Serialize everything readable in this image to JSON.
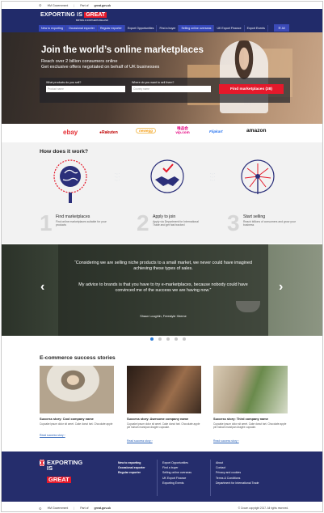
{
  "govbar": {
    "hm": "HM Government",
    "part_of": "Part of",
    "site": "great.gov.uk"
  },
  "header": {
    "logo_word": "EXPORTING IS",
    "logo_great": "GREAT",
    "logo_sub": "BRITAIN & NORTHERN IRELAND",
    "nav": [
      "New to exporting",
      "Occasional exporter",
      "Regular exporter",
      "Export Opportunities",
      "Find a buyer",
      "Selling online overseas",
      "UK Export Finance",
      "Export Events"
    ],
    "all_label": "All"
  },
  "hero": {
    "title": "Join the world’s online marketplaces",
    "line1": "Reach over 2 billion consumers online",
    "line2": "Get exclusive offers negotiated on behalf of UK businesses",
    "products_label": "What products do you sell?",
    "products_placeholder": "Product name",
    "country_label": "Where do you want to sell them?",
    "country_placeholder": "Country name",
    "button": "Find marketplaces (38)"
  },
  "marketplaces": [
    "ebay",
    "Rakuten",
    "newegg",
    "唯品会 vip.com",
    "Flipkart",
    "amazon"
  ],
  "how": {
    "title": "How does it work?",
    "steps": [
      {
        "num": "1",
        "title": "Find marketplaces",
        "desc": "Find online marketplaces suitable for your products"
      },
      {
        "num": "2",
        "title": "Apply to join",
        "desc": "Apply via Department for International Trade and get fast tracked"
      },
      {
        "num": "3",
        "title": "Start selling",
        "desc": "Reach billions of consumers and grow your business"
      }
    ]
  },
  "testimonial": {
    "quote1": "“Considering we are selling niche products to a small market, we never could have imagined achieving these types of sales.",
    "quote2": "My advice to brands is that you have to try e-marketplaces, because nobody could have convinced me of the success we are having now.”",
    "author": "Shaun Loughlin, Freestyle Xtreme"
  },
  "stories": {
    "title": "E-commerce success stories",
    "cards": [
      {
        "title": "Success story: Cool company name",
        "text": "Cupcake ipsum dolor sit amet. Cake donut tart. Chocolate apple",
        "link": "Read success story ›"
      },
      {
        "title": "Success story: Awesome company name",
        "text": "Cupcake ipsum dolor sit amet. Cake donut tart. Chocolate apple pie halvah marzipan dragée cupcake.",
        "link": "Read success story ›"
      },
      {
        "title": "Success story: Third company name",
        "text": "Cupcake ipsum dolor sit amet. Cake donut tart. Chocolate apple pie halvah marzipan dragée cupcake.",
        "link": "Read success story ›"
      }
    ]
  },
  "footer": {
    "logo_line1": "EXPORTING",
    "logo_line2": "IS",
    "logo_great": "GREAT",
    "col1": [
      "New to exporting",
      "Occasional exporter",
      "Regular exporter"
    ],
    "col2": [
      "Export Opportunities",
      "Find a buyer",
      "Selling online overseas",
      "UK Export Finance",
      "Exporting Events"
    ],
    "col3": [
      "About",
      "Contact",
      "Privacy and cookies",
      "Terms & Conditions",
      "Department for International Trade"
    ],
    "copyright": "© Crown copyright 2017. All rights reserved."
  },
  "colors": {
    "navy": "#212b6a",
    "red": "#e5192b",
    "link": "#2a62b8",
    "active_dot": "#2a7bd6"
  }
}
